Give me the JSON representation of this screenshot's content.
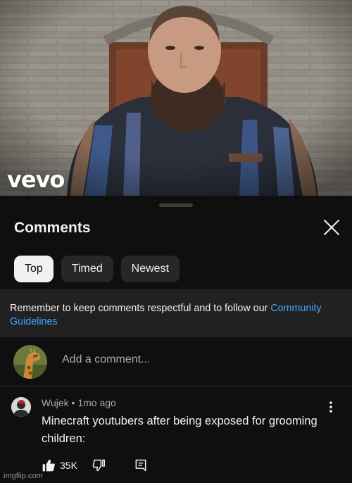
{
  "video": {
    "brand": "vevo"
  },
  "comments_panel": {
    "title": "Comments",
    "filters": [
      {
        "label": "Top",
        "active": true
      },
      {
        "label": "Timed",
        "active": false
      },
      {
        "label": "Newest",
        "active": false
      }
    ],
    "notice_text": "Remember to keep comments respectful and to follow our ",
    "notice_link": "Community Guidelines",
    "add_comment_placeholder": "Add a comment...",
    "comment": {
      "author": "Wujek",
      "age": "1mo ago",
      "separator": " • ",
      "text": "Minecraft youtubers after being exposed for grooming children:",
      "likes": "35K"
    }
  },
  "watermark": "imgflip.com",
  "colors": {
    "background": "#0f0f0f",
    "chip": "#272727",
    "link": "#3ea6ff",
    "notice_bg": "#212121"
  }
}
